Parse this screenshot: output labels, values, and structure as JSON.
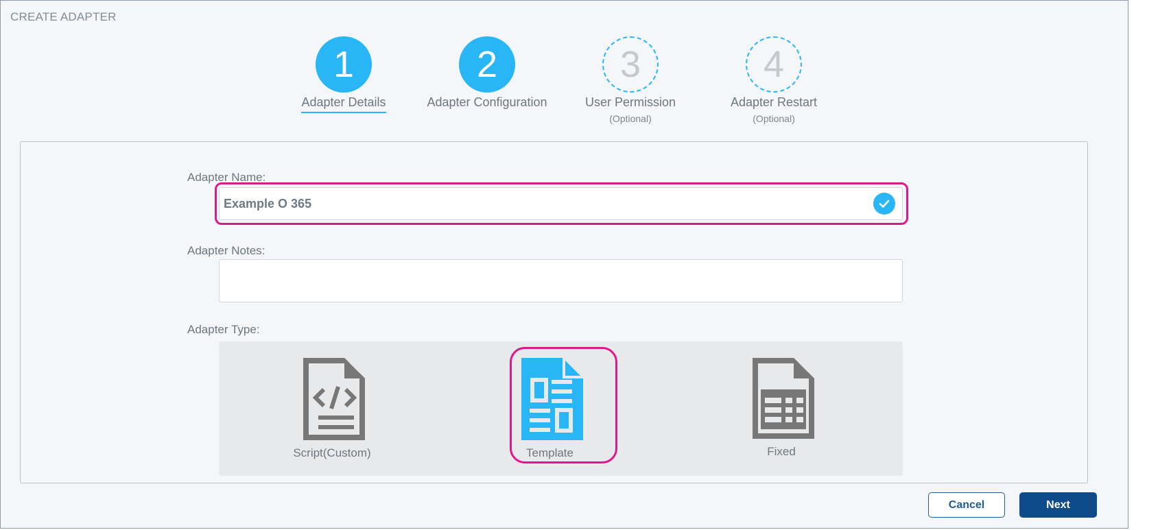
{
  "page": {
    "title": "CREATE ADAPTER"
  },
  "stepper": {
    "steps": [
      {
        "number": "1",
        "label": "Adapter Details",
        "sub": "",
        "state": "completed",
        "active": true
      },
      {
        "number": "2",
        "label": "Adapter Configuration",
        "sub": "",
        "state": "completed",
        "active": false
      },
      {
        "number": "3",
        "label": "User Permission",
        "sub": "(Optional)",
        "state": "pending",
        "active": false
      },
      {
        "number": "4",
        "label": "Adapter Restart",
        "sub": "(Optional)",
        "state": "pending",
        "active": false
      }
    ]
  },
  "form": {
    "name_label": "Adapter Name:",
    "name_value": "Example O 365",
    "notes_label": "Adapter Notes:",
    "notes_value": "",
    "type_label": "Adapter Type:",
    "types": [
      {
        "label": "Script(Custom)",
        "icon": "code-document-icon",
        "selected": false
      },
      {
        "label": "Template",
        "icon": "template-document-icon",
        "selected": true
      },
      {
        "label": "Fixed",
        "icon": "table-document-icon",
        "selected": false
      }
    ]
  },
  "buttons": {
    "cancel": "Cancel",
    "next": "Next"
  },
  "colors": {
    "accent": "#29b6f6",
    "highlight": "#e0168a",
    "primary_button": "#0f4b8a",
    "icon_gray": "#777777"
  }
}
